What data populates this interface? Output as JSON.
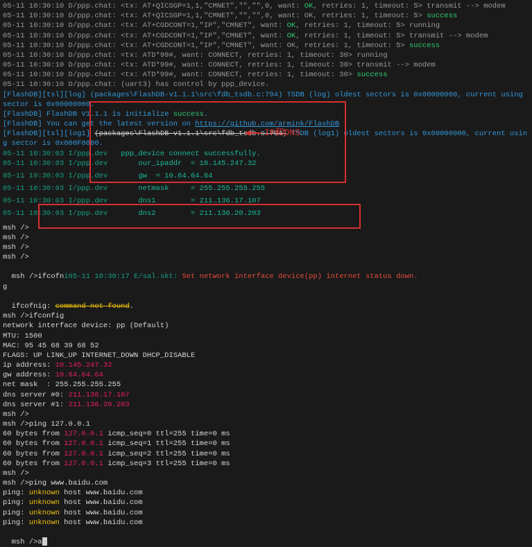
{
  "annotation": {
    "label": "IP和DNS"
  },
  "log_top": [
    [
      [
        "gray",
        "05-11 10:30:10 D/ppp.chat: <tx: AT+QICSGP=1,1,\"CMNET\",\"\",\"\",0, want: "
      ],
      [
        "green",
        "OK"
      ],
      [
        "gray",
        ", retries: 1, timeout: 5> transmit --> modem"
      ]
    ],
    [
      [
        "gray",
        "05-11 10:30:10 D/ppp.chat: <tx: AT+QICSGP=1,1,\"CMNET\",\"\",\"\",0, want: OK, retries: 1, timeout: 5> "
      ],
      [
        "green",
        "success"
      ]
    ],
    [
      [
        "gray",
        "05-11 10:30:10 D/ppp.chat: <tx: AT+CGDCONT=1,\"IP\",\"CMNET\", want: "
      ],
      [
        "green",
        "OK"
      ],
      [
        "gray",
        ", retries: 1, timeout: 5> running"
      ]
    ],
    [
      [
        "gray",
        "05-11 10:30:10 D/ppp.chat: <tx: AT+CGDCONT=1,\"IP\",\"CMNET\", want: "
      ],
      [
        "green",
        "OK"
      ],
      [
        "gray",
        ", retries: 1, timeout: 5> transmit --> modem"
      ]
    ],
    [
      [
        "gray",
        "05-11 10:30:10 D/ppp.chat: <tx: AT+CGDCONT=1,\"IP\",\"CMNET\", want: OK, retries: 1, timeout: 5> "
      ],
      [
        "green",
        "success"
      ]
    ],
    [
      [
        "gray",
        "05-11 10:30:10 D/ppp.chat: <tx: ATD*99#, want: CONNECT, retries: 1, timeout: 30> running"
      ]
    ],
    [
      [
        "gray",
        "05-11 10:30:10 D/ppp.chat: <tx: ATD*99#, want: CONNECT, retries: 1, timeout: 30> transmit --> modem"
      ]
    ],
    [
      [
        "gray",
        "05-11 10:30:10 D/ppp.chat: <tx: ATD*99#, want: CONNECT, retries: 1, timeout: 30> "
      ],
      [
        "green",
        "success"
      ]
    ],
    [
      [
        "gray",
        "05-11 10:30:10 D/ppp.chat: (uart3) has control by ppp_device."
      ]
    ],
    [
      [
        "cyan",
        "[FlashDB][tsl][log] (packages\\FlashDB-v1.1.1\\src\\fdb_tsdb.c:794) TSDB (log) oldest sectors is 0x00000000, current using "
      ]
    ],
    [
      [
        "cyan",
        "sector is 0x00000000."
      ]
    ],
    [
      [
        "cyan",
        "[FlashDB] FlashDB V1.1.1 is initialize "
      ],
      [
        "green",
        "success"
      ],
      [
        "cyan",
        "."
      ]
    ],
    [
      [
        "cyan",
        "[FlashDB] You can get the latest version on "
      ],
      [
        "link",
        "https://github.com/armink/FlashDB"
      ],
      [
        "cyan",
        " ."
      ]
    ],
    [
      [
        "cyan",
        "[FlashDB][tsl][log1] "
      ],
      [
        "strike",
        "(packages\\FlashDB-v1.1.1\\src\\fdb_tsdb.c:794)"
      ],
      [
        "cyan",
        " TSDB (log1) oldest sectors is 0x00000000, current usin"
      ]
    ],
    [
      [
        "cyan",
        "g sector is 0x000F0000."
      ]
    ]
  ],
  "ppp": [
    {
      "prefix": "05-11 10:30:03 I/ppp.dev",
      "text": "ppp_device connect successfully."
    },
    {
      "prefix": "05-11 10:30:03 I/ppp.dev",
      "text": "    our_ipaddr  = 10.145.247.32"
    },
    {
      "prefix": "05-11 10:30:03 I/ppp.dev",
      "text": "    gw  = 10.64.64.64"
    },
    {
      "prefix": "05-11 10:30:03 I/ppp.dev",
      "text": "    netmask     = 255.255.255.255"
    },
    {
      "prefix": "05-11 10:30:03 I/ppp.dev",
      "text": "    dns1        = 211.136.17.107"
    },
    {
      "prefix": "05-11 10:30:03 I/ppp.dev",
      "text": "    dns2        = 211.136.20.203"
    }
  ],
  "mid": [
    "msh />",
    "msh />",
    "msh />",
    "msh />"
  ],
  "err": {
    "prompt": "msh />ifcofn",
    "stamp": "i05-11 10:30:17 E/sal.skt: ",
    "msg": "Set network interface device(pp) internet status down.",
    "g": "g"
  },
  "notfound": {
    "pre": "ifcofnig: ",
    "mid": "command not found",
    "post": "."
  },
  "ifconfig": [
    [
      [
        "white",
        "msh />ifconfig"
      ]
    ],
    [
      [
        "white",
        "network interface device: pp (Default)"
      ]
    ],
    [
      [
        "white",
        "MTU: 1500"
      ]
    ],
    [
      [
        "white",
        "MAC: 95 45 68 39 68 52"
      ]
    ],
    [
      [
        "white",
        "FLAGS: UP LINK_UP INTERNET_DOWN DHCP_DISABLE"
      ]
    ],
    [
      [
        "white",
        "ip address: "
      ],
      [
        "magenta",
        "10.145.247.32"
      ]
    ],
    [
      [
        "white",
        "gw address: "
      ],
      [
        "magenta",
        "10.64.64.64"
      ]
    ],
    [
      [
        "white",
        "net mask  : 255.255.255.255"
      ]
    ],
    [
      [
        "white",
        "dns server #0: "
      ],
      [
        "magenta",
        "211.136.17.107"
      ]
    ],
    [
      [
        "white",
        "dns server #1: "
      ],
      [
        "magenta",
        "211.136.20.203"
      ]
    ]
  ],
  "ping1": {
    "cmd": "msh />ping 127.0.0.1",
    "lines": [
      "60 bytes from 127.0.0.1 icmp_seq=0 ttl=255 time=0 ms",
      "60 bytes from 127.0.0.1 icmp_seq=1 ttl=255 time=0 ms",
      "60 bytes from 127.0.0.1 icmp_seq=2 ttl=255 time=0 ms",
      "60 bytes from 127.0.0.1 icmp_seq=3 ttl=255 time=0 ms"
    ],
    "ip": "127.0.0.1"
  },
  "ping2": {
    "cmd": "msh />ping www.baidu.com",
    "lines": [
      {
        "pre": "ping: ",
        "mid": "unknown",
        "post": " host www.baidu.com"
      },
      {
        "pre": "ping: ",
        "mid": "unknown",
        "post": " host www.baidu.com"
      },
      {
        "pre": "ping: ",
        "mid": "unknown",
        "post": " host www.baidu.com"
      },
      {
        "pre": "ping: ",
        "mid": "unknown",
        "post": " host www.baidu.com"
      }
    ]
  },
  "final_prompt": "msh />a"
}
